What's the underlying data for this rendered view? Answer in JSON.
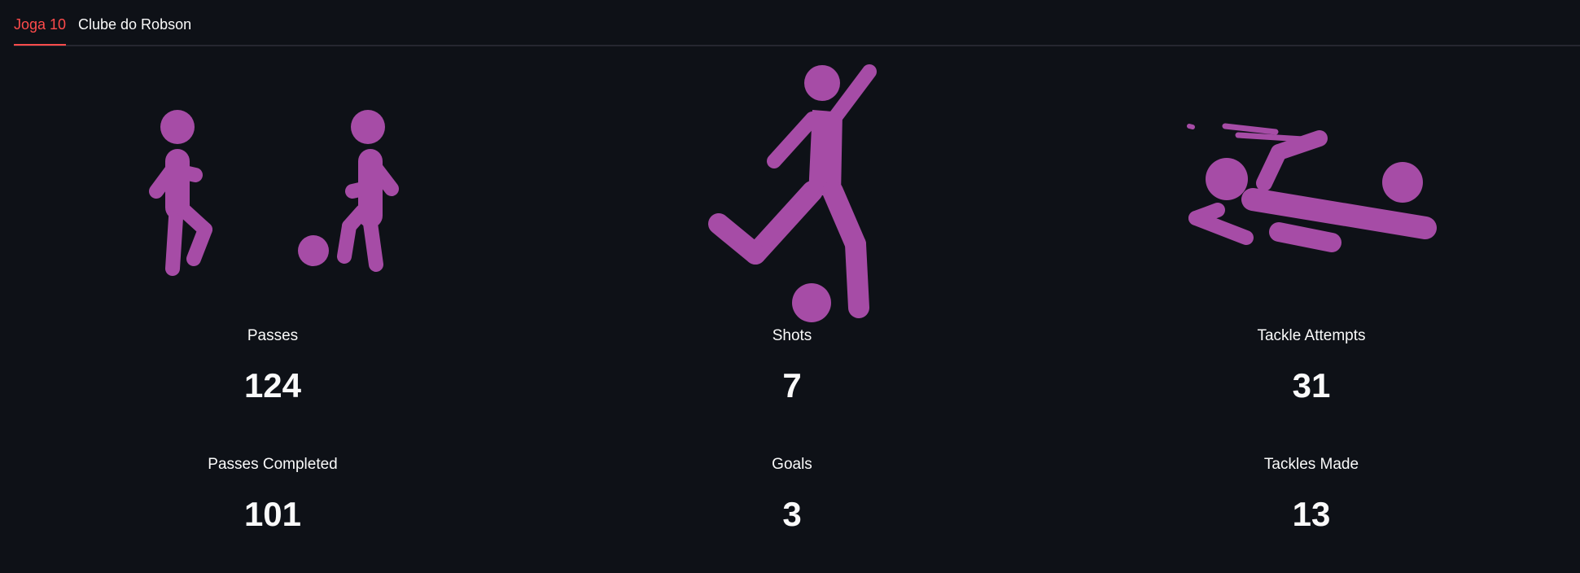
{
  "tabs": [
    {
      "label": "Joga 10",
      "active": true
    },
    {
      "label": "Clube do Robson",
      "active": false
    }
  ],
  "columns": [
    {
      "icon": "two-players-passing-icon",
      "metrics": [
        {
          "label": "Passes",
          "value": "124"
        },
        {
          "label": "Passes Completed",
          "value": "101"
        }
      ]
    },
    {
      "icon": "player-kicking-ball-icon",
      "metrics": [
        {
          "label": "Shots",
          "value": "7"
        },
        {
          "label": "Goals",
          "value": "3"
        }
      ]
    },
    {
      "icon": "sliding-tackle-icon",
      "metrics": [
        {
          "label": "Tackle Attempts",
          "value": "31"
        },
        {
          "label": "Tackles Made",
          "value": "13"
        }
      ]
    }
  ],
  "colors": {
    "background": "#0e1117",
    "accent": "#ff4b4b",
    "icon": "#a64ca6",
    "text": "#fafafa"
  }
}
